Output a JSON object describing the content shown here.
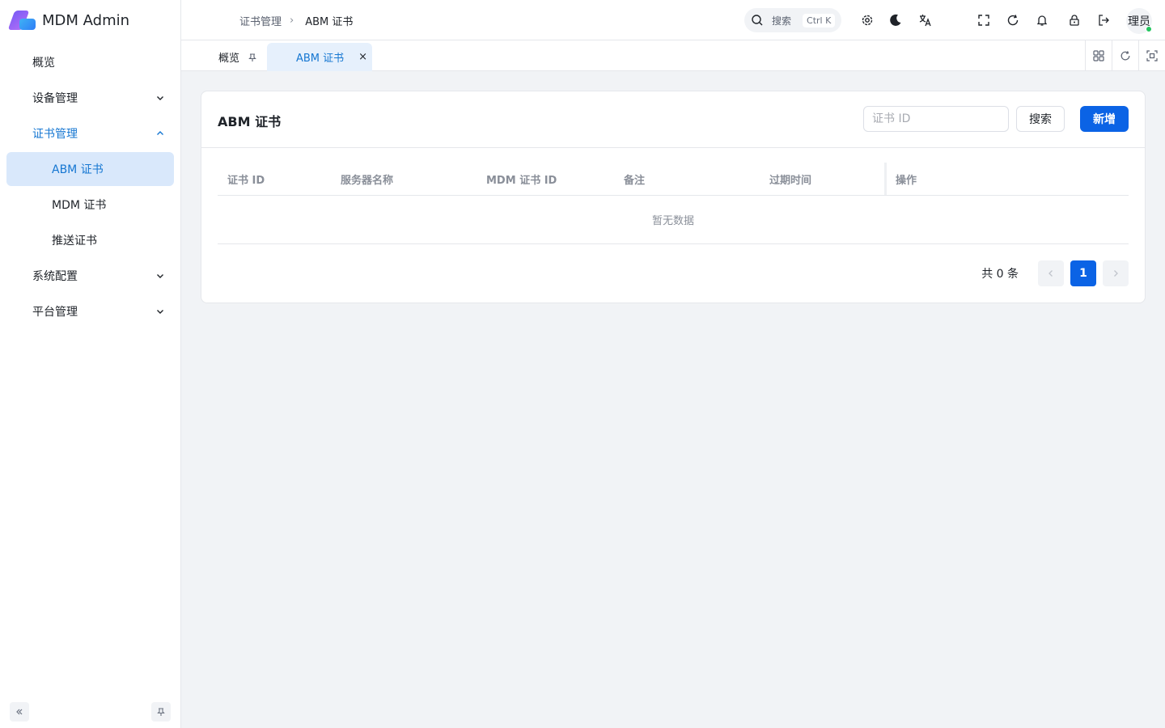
{
  "app": {
    "title": "MDM Admin"
  },
  "sidebar": {
    "items": [
      {
        "label": "概览"
      },
      {
        "label": "设备管理"
      },
      {
        "label": "证书管理"
      },
      {
        "label": "ABM 证书"
      },
      {
        "label": "MDM 证书"
      },
      {
        "label": "推送证书"
      },
      {
        "label": "系统配置"
      },
      {
        "label": "平台管理"
      }
    ]
  },
  "header": {
    "breadcrumb": [
      "证书管理",
      "ABM 证书"
    ],
    "search_label": "搜索",
    "search_shortcut": "Ctrl K",
    "user_name": "理员"
  },
  "tabs": [
    {
      "label": "概览"
    },
    {
      "label": "ABM 证书"
    }
  ],
  "page": {
    "title": "ABM 证书",
    "filter": {
      "placeholder": "证书 ID"
    },
    "search_button": "搜索",
    "add_button": "新增"
  },
  "table": {
    "columns": [
      "证书 ID",
      "服务器名称",
      "MDM 证书 ID",
      "备注",
      "过期时间",
      "操作"
    ],
    "empty_text": "暂无数据"
  },
  "pagination": {
    "total_text": "共 0 条",
    "current_page": "1"
  },
  "colors": {
    "primary": "#0b63e5",
    "active_text": "#1677d2",
    "active_bg": "#d9e8fb",
    "online": "#22c55e"
  }
}
